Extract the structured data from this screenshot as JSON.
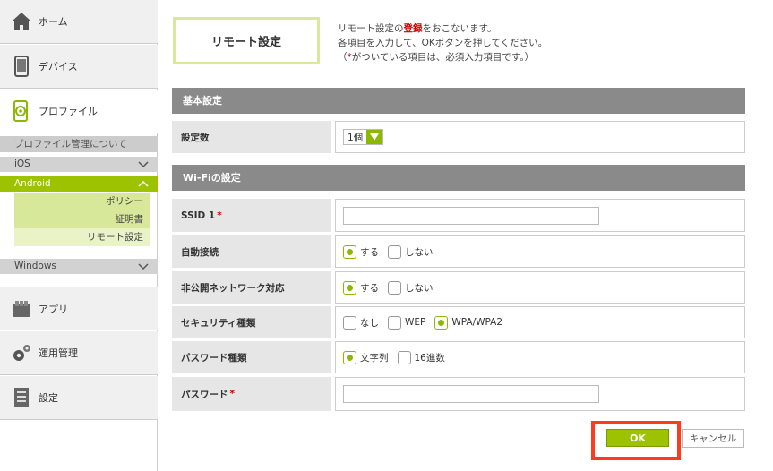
{
  "sidebar": {
    "nav": [
      {
        "label": "ホーム",
        "icon": "home-icon"
      },
      {
        "label": "デバイス",
        "icon": "smartphone-icon"
      },
      {
        "label": "プロファイル",
        "icon": "profile-gear-icon"
      }
    ],
    "profile_about": "プロファイル管理について",
    "os": [
      {
        "label": "iOS",
        "chevron": "down"
      },
      {
        "label": "Android",
        "chevron": "up"
      },
      {
        "label": "Windows",
        "chevron": "down"
      }
    ],
    "android_items": [
      "ポリシー",
      "証明書",
      "リモート設定"
    ],
    "bottom_nav": [
      {
        "label": "アプリ",
        "icon": "apps-icon"
      },
      {
        "label": "運用管理",
        "icon": "gears-icon"
      },
      {
        "label": "設定",
        "icon": "settings-doc-icon"
      }
    ]
  },
  "main": {
    "title": "リモート設定",
    "intro": {
      "line1_pre": "リモート設定の",
      "line1_red": "登録",
      "line1_post": "をおこないます。",
      "line2": "各項目を入力して、OKボタンを押してください。",
      "line3_pre": "（",
      "line3_star": "*",
      "line3_post": "がついている項目は、必須入力項目です。）"
    },
    "sections": {
      "basic": "基本設定",
      "wifi": "Wi-Fiの設定"
    },
    "rows": {
      "count_label": "設定数",
      "count_value": "1個",
      "ssid_label": "SSID 1",
      "ssid_required": "*",
      "ssid_value": "",
      "auto_label": "自動接続",
      "hidden_label": "非公開ネットワーク対応",
      "security_label": "セキュリティ種類",
      "pwtype_label": "パスワード種類",
      "password_label": "パスワード",
      "password_required": "*",
      "password_value": ""
    },
    "options": {
      "yes": "する",
      "no": "しない",
      "none": "なし",
      "wep": "WEP",
      "wpa": "WPA/WPA2",
      "text": "文字列",
      "hex": "16進数"
    },
    "buttons": {
      "ok": "OK",
      "cancel": "キャンセル"
    }
  },
  "colors": {
    "accent": "#9dc300",
    "section_bar": "#8a8a8a",
    "highlight": "#ff3b1f",
    "required": "#cc0000"
  }
}
